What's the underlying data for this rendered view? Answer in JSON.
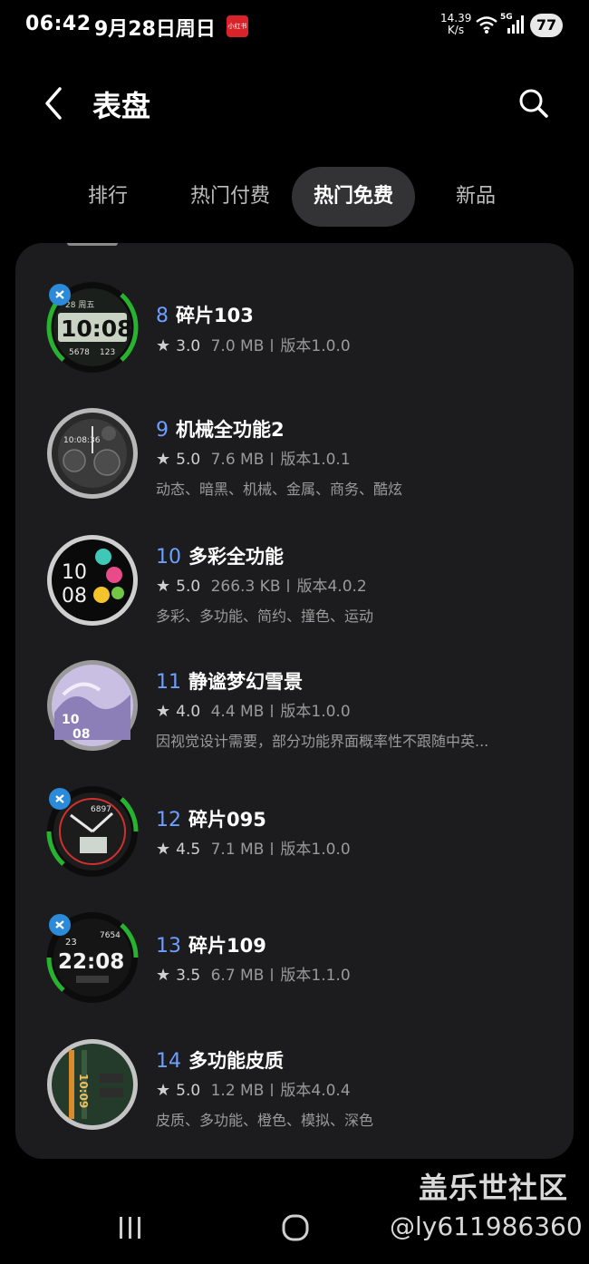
{
  "status_bar": {
    "time": "06:42",
    "date": "9月28日周日",
    "badge_text": "小红书",
    "net_speed_value": "14.39",
    "net_speed_unit": "K/s",
    "network": "5G",
    "battery": "77"
  },
  "header": {
    "title": "表盘",
    "back_icon": "chevron-left-icon",
    "search_icon": "search-icon"
  },
  "tabs": [
    {
      "label": "排行",
      "active": false
    },
    {
      "label": "热门付费",
      "active": false
    },
    {
      "label": "热门免费",
      "active": true
    },
    {
      "label": "新品",
      "active": false
    }
  ],
  "items": [
    {
      "rank": "8",
      "name": "碎片103",
      "rating": "3.0",
      "size": "7.0 MB",
      "version": "版本1.0.0",
      "tags": "",
      "badge": true
    },
    {
      "rank": "9",
      "name": "机械全功能2",
      "rating": "5.0",
      "size": "7.6 MB",
      "version": "版本1.0.1",
      "tags": "动态、暗黑、机械、金属、商务、酷炫",
      "badge": false
    },
    {
      "rank": "10",
      "name": "多彩全功能",
      "rating": "5.0",
      "size": "266.3 KB",
      "version": "版本4.0.2",
      "tags": "多彩、多功能、简约、撞色、运动",
      "badge": false
    },
    {
      "rank": "11",
      "name": "静谧梦幻雪景",
      "rating": "4.0",
      "size": "4.4 MB",
      "version": "版本1.0.0",
      "tags": "因视觉设计需要，部分功能界面概率性不跟随中英...",
      "badge": false
    },
    {
      "rank": "12",
      "name": "碎片095",
      "rating": "4.5",
      "size": "7.1 MB",
      "version": "版本1.0.0",
      "tags": "",
      "badge": true
    },
    {
      "rank": "13",
      "name": "碎片109",
      "rating": "3.5",
      "size": "6.7 MB",
      "version": "版本1.1.0",
      "tags": "",
      "badge": true
    },
    {
      "rank": "14",
      "name": "多功能皮质",
      "rating": "5.0",
      "size": "1.2 MB",
      "version": "版本4.0.4",
      "tags": "皮质、多功能、橙色、模拟、深色",
      "badge": false
    }
  ],
  "watch_face_texts": {
    "f8_time": "10:08",
    "f8_top": "28 周五",
    "f8_steps": "5678",
    "f8_hr": "123",
    "f9_time": "10:08:36",
    "f10_hour": "10",
    "f10_min": "08",
    "f11_hour": "10",
    "f11_min": "08",
    "f12_steps": "6897",
    "f13_time": "22:08",
    "f13_steps": "7654",
    "f13_day": "23",
    "f14_time": "10:09"
  },
  "watermark": {
    "line1": "盖乐世社区",
    "line2": "@ly611986360"
  },
  "colors": {
    "background": "#000000",
    "card": "#1c1c1e",
    "active_tab": "#333335",
    "rank_accent": "#6e9eff",
    "meta_text": "#9a9a9a"
  },
  "nav_icons": [
    "recents-icon",
    "home-icon"
  ]
}
